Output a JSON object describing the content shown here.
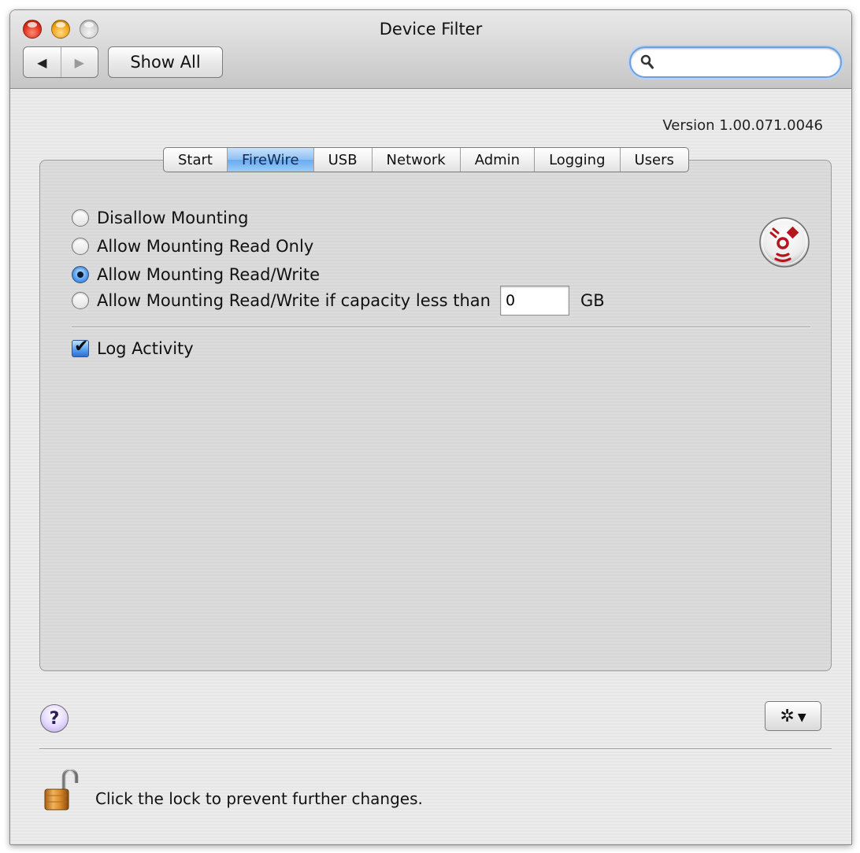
{
  "window": {
    "title": "Device Filter"
  },
  "toolbar": {
    "back_glyph": "◀",
    "forward_glyph": "▶",
    "show_all_label": "Show All",
    "search_value": "",
    "search_icon": "magnifier-icon"
  },
  "version_text": "Version 1.00.071.0046",
  "tabs": [
    {
      "label": "Start",
      "selected": false
    },
    {
      "label": "FireWire",
      "selected": true
    },
    {
      "label": "USB",
      "selected": false
    },
    {
      "label": "Network",
      "selected": false
    },
    {
      "label": "Admin",
      "selected": false
    },
    {
      "label": "Logging",
      "selected": false
    },
    {
      "label": "Users",
      "selected": false
    }
  ],
  "firewire": {
    "options": [
      {
        "label": "Disallow Mounting",
        "selected": false
      },
      {
        "label": "Allow Mounting Read Only",
        "selected": false
      },
      {
        "label": "Allow Mounting Read/Write",
        "selected": true
      },
      {
        "label": "Allow Mounting Read/Write if capacity less than",
        "selected": false
      }
    ],
    "capacity_value": "0",
    "capacity_unit": "GB",
    "log_activity_label": "Log Activity",
    "log_activity_checked": true,
    "icon": "firewire-icon"
  },
  "footer": {
    "help_glyph": "?",
    "action_glyph": "✲",
    "action_arrow": "▼",
    "lock_text": "Click the lock to prevent further changes.",
    "lock_icon": "unlocked-padlock-icon"
  },
  "colors": {
    "selected_tab": "#8ec0f2",
    "firewire_red": "#b3171c",
    "search_focus": "#6aa0e0"
  }
}
